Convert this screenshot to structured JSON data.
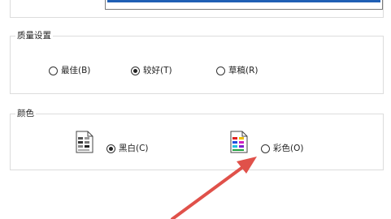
{
  "quality": {
    "group_label": "质量设置",
    "options": [
      {
        "label": "最佳(B)",
        "selected": false
      },
      {
        "label": "较好(T)",
        "selected": true
      },
      {
        "label": "草稿(R)",
        "selected": false
      }
    ]
  },
  "color": {
    "group_label": "颜色",
    "options": [
      {
        "label": "黑白(C)",
        "selected": true,
        "icon": "grayscale-document-icon"
      },
      {
        "label": "彩色(O)",
        "selected": false,
        "icon": "color-document-icon"
      }
    ]
  },
  "annotation": {
    "arrow_color": "#e0514a",
    "points_to": "彩色(O)"
  },
  "colors": {
    "preview_bar": "#1f5fb4",
    "group_border": "#dcdcdc"
  }
}
